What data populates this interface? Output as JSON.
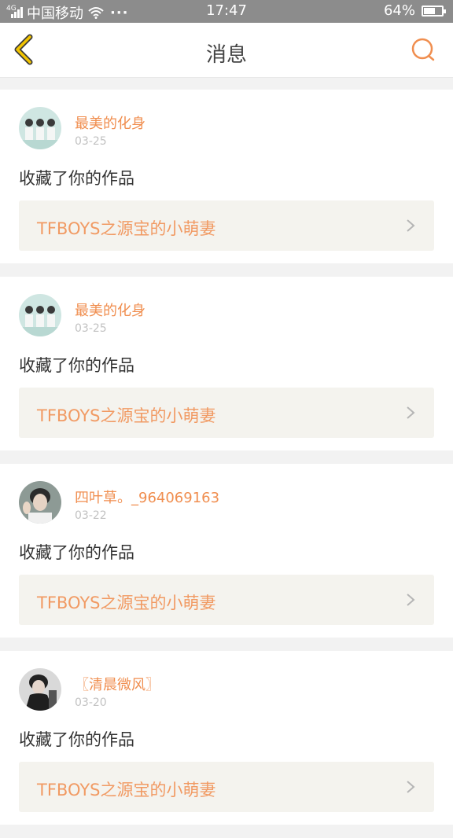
{
  "status_bar": {
    "carrier": "中国移动",
    "network": "4G",
    "more": "···",
    "time": "17:47",
    "battery": "64%",
    "battery_level": 0.64
  },
  "header": {
    "title": "消息",
    "back_icon": "chevron-left-icon",
    "search_icon": "search-icon"
  },
  "colors": {
    "accent": "#f08e4f",
    "link_bg": "#f4f3ee",
    "back_icon": "#e0b000"
  },
  "messages": [
    {
      "username": "最美的化身",
      "date": "03-25",
      "action": "收藏了你的作品",
      "work_title": "TFBOYS之源宝的小萌妻"
    },
    {
      "username": "最美的化身",
      "date": "03-25",
      "action": "收藏了你的作品",
      "work_title": "TFBOYS之源宝的小萌妻"
    },
    {
      "username": "四叶草。_964069163",
      "date": "03-22",
      "action": "收藏了你的作品",
      "work_title": "TFBOYS之源宝的小萌妻"
    },
    {
      "username": "〖清晨微风〗",
      "date": "03-20",
      "action": "收藏了你的作品",
      "work_title": "TFBOYS之源宝的小萌妻"
    }
  ]
}
